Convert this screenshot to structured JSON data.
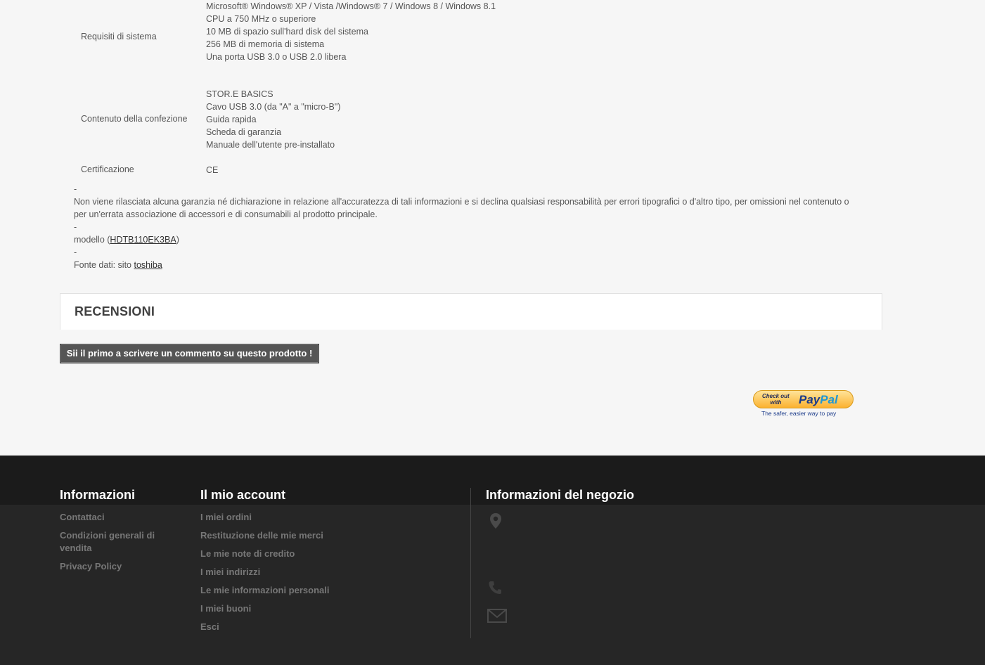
{
  "specs": [
    {
      "label": "Requisiti di sistema",
      "values": [
        "Microsoft® Windows® XP / Vista /Windows® 7 / Windows 8 / Windows 8.1",
        "CPU a 750 MHz o superiore",
        "10 MB di spazio sull'hard disk del sistema",
        "256 MB di memoria di sistema",
        "Una porta USB 3.0 o USB 2.0 libera"
      ]
    },
    {
      "label": "Contenuto della confezione",
      "values": [
        "STOR.E BASICS",
        "Cavo USB 3.0 (da \"A\" a \"micro-B\")",
        "Guida rapida",
        "Scheda di garanzia",
        "Manuale dell'utente pre-installato"
      ]
    },
    {
      "label": "Certificazione",
      "values": [
        "CE"
      ]
    }
  ],
  "notes": {
    "dash": "-",
    "disclaimer": "Non viene rilasciata alcuna garanzia né dichiarazione in relazione all'accuratezza di tali informazioni e si declina qualsiasi responsabilità per errori tipografici o d'altro tipo, per omissioni nel contenuto o per un'errata associazione di accessori e di consumabili al prodotto principale.",
    "model_prefix": "modello (",
    "model_link": "HDTB110EK3BA",
    "model_suffix": ")",
    "source_prefix": "Fonte dati: sito ",
    "source_link": "toshiba"
  },
  "reviews": {
    "title": "RECENSIONI",
    "first_review_button": "Sii il primo a scrivere un commento su questo prodotto !"
  },
  "paypal": {
    "checkout_line1": "Check out",
    "checkout_line2": "with",
    "logo_pay": "Pay",
    "logo_pal": "Pal",
    "tagline": "The safer, easier way to pay"
  },
  "footer": {
    "info": {
      "title": "Informazioni",
      "links": [
        "Contattaci",
        "Condizioni generali di vendita",
        "Privacy Policy"
      ]
    },
    "account": {
      "title": "Il mio account",
      "links": [
        "I miei ordini",
        "Restituzione delle mie merci",
        "Le mie note di credito",
        "I miei indirizzi",
        "Le mie informazioni personali",
        "I miei buoni",
        "Esci"
      ]
    },
    "store": {
      "title": "Informazioni del negozio"
    }
  }
}
